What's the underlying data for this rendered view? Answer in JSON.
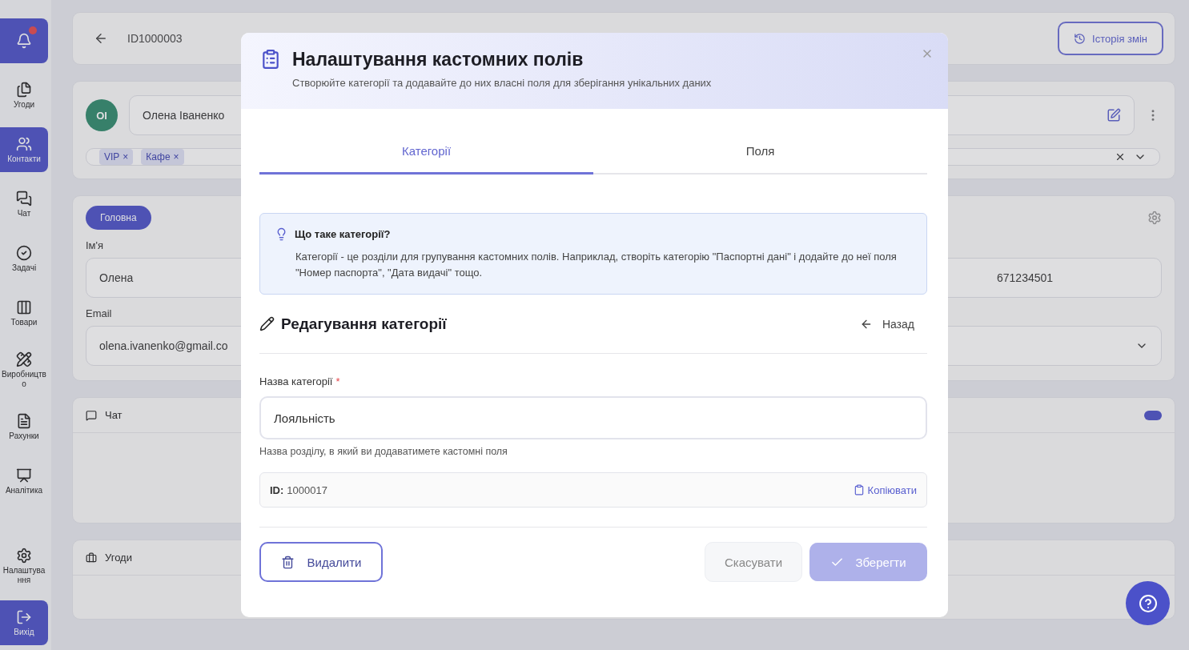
{
  "sidebar": {
    "items": [
      {
        "kind": "deals",
        "label": "Угоди",
        "selected": false
      },
      {
        "kind": "contacts",
        "label": "Контакти",
        "selected": true
      },
      {
        "kind": "chat",
        "label": "Чат",
        "selected": false
      },
      {
        "kind": "tasks",
        "label": "Задачі",
        "selected": false
      },
      {
        "kind": "products",
        "label": "Товари",
        "selected": false
      },
      {
        "kind": "production",
        "label": "Виробництво",
        "selected": false
      },
      {
        "kind": "invoices",
        "label": "Рахунки",
        "selected": false
      },
      {
        "kind": "analytics",
        "label": "Аналітика",
        "selected": false
      },
      {
        "kind": "settings",
        "label": "Налаштування",
        "selected": false
      }
    ],
    "notification_button": {
      "kind": "notifications"
    },
    "logout_button": {
      "label": "Вихід"
    }
  },
  "header": {
    "record_id": "ID1000003",
    "history_button": "Історія змін"
  },
  "contact": {
    "avatar": "ОІ",
    "name": "Олена Іваненко",
    "tags": [
      {
        "label": "VIP",
        "remove": "×"
      },
      {
        "label": "Кафе",
        "remove": "×"
      }
    ]
  },
  "main_card": {
    "tab": "Головна",
    "fields": [
      {
        "label": "Ім'я",
        "value": "Олена"
      },
      {
        "label": "Email",
        "value": "olena.ivanenko@gmail.co"
      }
    ],
    "right_fields": [
      {
        "kind": "input",
        "value": "671234501"
      },
      {
        "kind": "select"
      }
    ]
  },
  "chat_panel": {
    "title": "Чат"
  },
  "deals_panel": {
    "title": "Угоди"
  },
  "modal": {
    "title": "Налаштування кастомних полів",
    "subtitle": "Створюйте категорії та додавайте до них власні поля для зберігання унікальних даних",
    "tabs": [
      {
        "label": "Категорії",
        "selected": true
      },
      {
        "label": "Поля",
        "selected": false
      }
    ],
    "info": {
      "title": "Що таке категорії?",
      "text": "Категорії - це розділи для групування кастомних полів. Наприклад, створіть категорію \"Паспортні дані\" і додайте до неї поля \"Номер паспорта\", \"Дата видачі\" тощо."
    },
    "section": {
      "title": "Редагування категорії",
      "back": "Назад"
    },
    "field": {
      "label": "Назва категорії",
      "required_mark": "*",
      "value": "Лояльність",
      "hint": "Назва розділу, в який ви додаватимете кастомні поля"
    },
    "id_row": {
      "label": "ID:",
      "value": "1000017",
      "copy": "Копіювати"
    },
    "actions": {
      "delete": "Видалити",
      "cancel": "Скасувати",
      "save": {
        "label": "Зберегти",
        "disabled": true
      }
    }
  }
}
